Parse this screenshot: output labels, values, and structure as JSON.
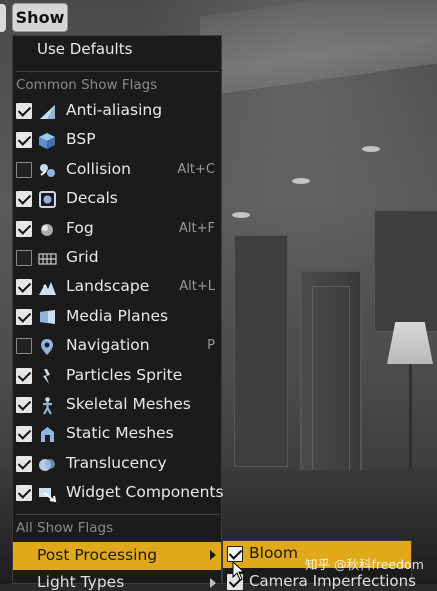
{
  "toolbar": {
    "show_label": "Show"
  },
  "menu": {
    "use_defaults_label": "Use Defaults",
    "common_header": "Common Show Flags",
    "all_header": "All Show Flags",
    "flags": [
      {
        "label": "Anti-aliasing",
        "checked": true,
        "shortcut": "",
        "icon": "anti-aliasing-icon"
      },
      {
        "label": "BSP",
        "checked": true,
        "shortcut": "",
        "icon": "bsp-cube-icon"
      },
      {
        "label": "Collision",
        "checked": false,
        "shortcut": "Alt+C",
        "icon": "collision-icon"
      },
      {
        "label": "Decals",
        "checked": true,
        "shortcut": "",
        "icon": "decals-icon"
      },
      {
        "label": "Fog",
        "checked": true,
        "shortcut": "Alt+F",
        "icon": "fog-icon"
      },
      {
        "label": "Grid",
        "checked": false,
        "shortcut": "",
        "icon": "grid-icon"
      },
      {
        "label": "Landscape",
        "checked": true,
        "shortcut": "Alt+L",
        "icon": "landscape-icon"
      },
      {
        "label": "Media Planes",
        "checked": true,
        "shortcut": "",
        "icon": "media-planes-icon"
      },
      {
        "label": "Navigation",
        "checked": false,
        "shortcut": "P",
        "icon": "navigation-icon"
      },
      {
        "label": "Particles Sprite",
        "checked": true,
        "shortcut": "",
        "icon": "particles-sprite-icon"
      },
      {
        "label": "Skeletal Meshes",
        "checked": true,
        "shortcut": "",
        "icon": "skeletal-mesh-icon"
      },
      {
        "label": "Static Meshes",
        "checked": true,
        "shortcut": "",
        "icon": "static-mesh-icon"
      },
      {
        "label": "Translucency",
        "checked": true,
        "shortcut": "",
        "icon": "translucency-icon"
      },
      {
        "label": "Widget Components",
        "checked": true,
        "shortcut": "",
        "icon": "widget-components-icon"
      }
    ],
    "post_processing_label": "Post Processing",
    "light_types_label": "Light Types"
  },
  "submenu": {
    "bloom_label": "Bloom",
    "bloom_checked": true,
    "camera_imperfections_label": "Camera Imperfections",
    "camera_imperfections_checked": true
  },
  "watermark": "知乎 @秋科freedom",
  "colors": {
    "highlight": "#e1a91a",
    "menu_bg": "#1b1b1b"
  }
}
